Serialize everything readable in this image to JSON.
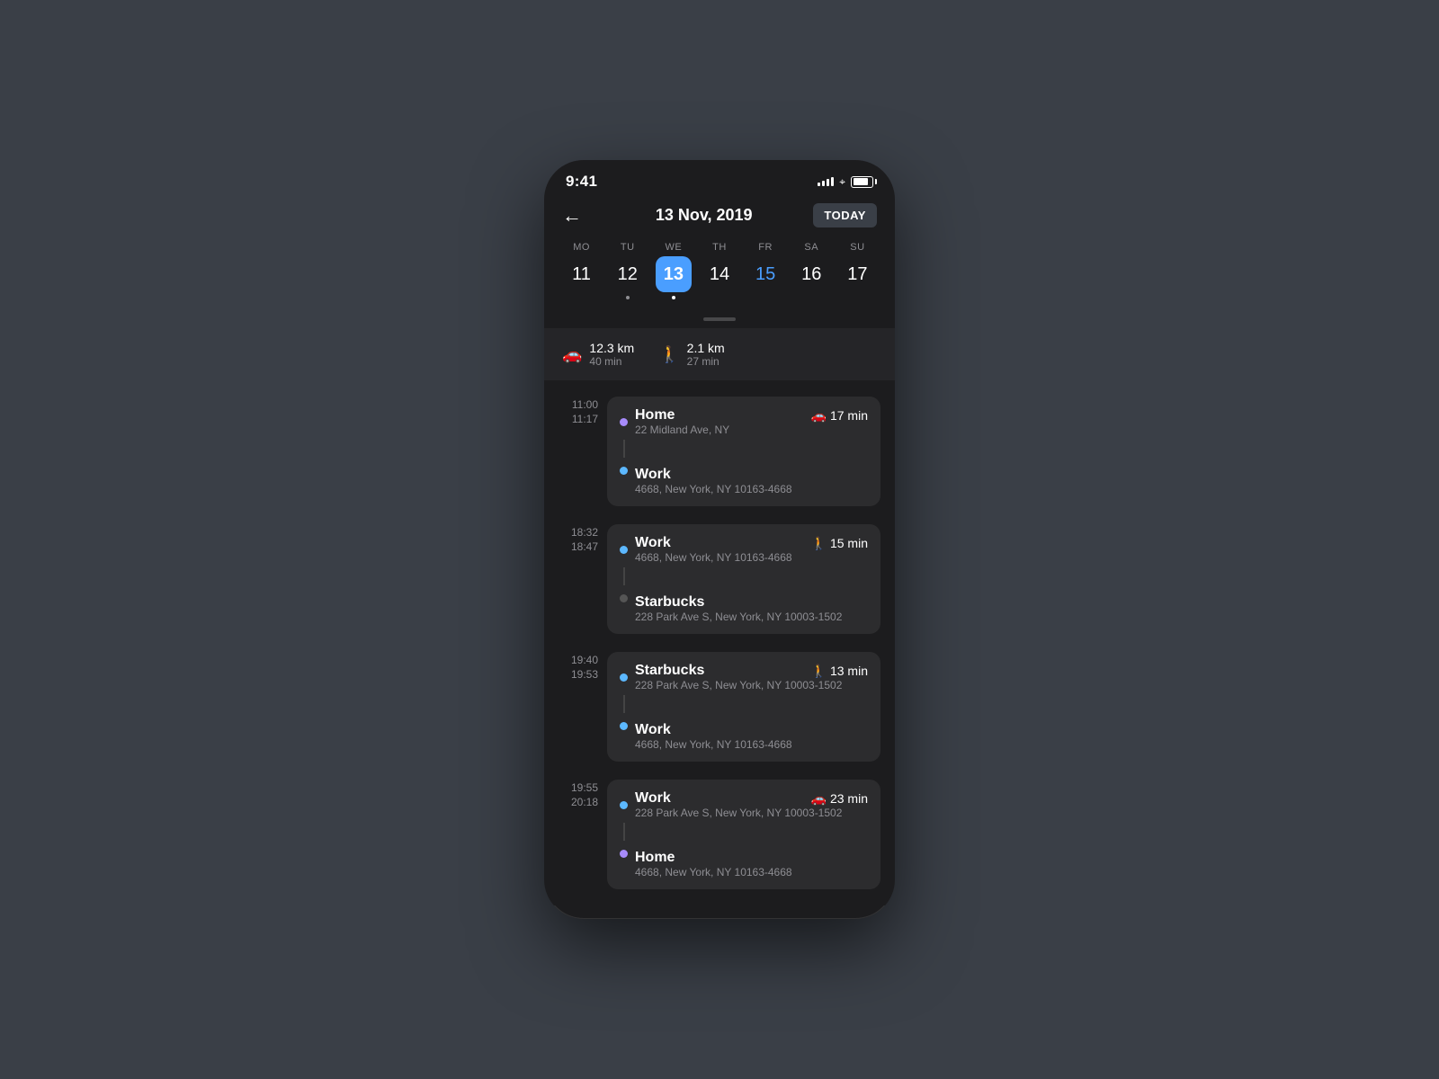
{
  "status": {
    "time": "9:41",
    "signal_bars": [
      4,
      6,
      8,
      10,
      12
    ],
    "wifi": "wifi",
    "battery_pct": 80
  },
  "header": {
    "back_label": "←",
    "title": "13 Nov, 2019",
    "today_label": "TODAY"
  },
  "calendar": {
    "days": [
      {
        "label": "MO",
        "num": "11",
        "selected": false,
        "today": false,
        "dot": false
      },
      {
        "label": "TU",
        "num": "12",
        "selected": false,
        "today": false,
        "dot": true
      },
      {
        "label": "WE",
        "num": "13",
        "selected": true,
        "today": false,
        "dot": true
      },
      {
        "label": "TH",
        "num": "14",
        "selected": false,
        "today": false,
        "dot": false
      },
      {
        "label": "FR",
        "num": "15",
        "selected": false,
        "today": true,
        "dot": false
      },
      {
        "label": "SA",
        "num": "16",
        "selected": false,
        "today": false,
        "dot": false
      },
      {
        "label": "SU",
        "num": "17",
        "selected": false,
        "today": false,
        "dot": false
      }
    ]
  },
  "summary": {
    "car": {
      "distance": "12.3 km",
      "duration": "40 min"
    },
    "walk": {
      "distance": "2.1 km",
      "duration": "27 min"
    }
  },
  "trips": [
    {
      "time_start": "11:00",
      "time_end": "11:17",
      "transport": "car",
      "transport_icon": "🚗",
      "transport_time": "17 min",
      "origin_name": "Home",
      "origin_addr": "22 Midland Ave, NY",
      "origin_dot_color": "#a78bfa",
      "dest_name": "Work",
      "dest_addr": "4668, New York, NY 10163-4668",
      "dest_dot_color": "#5cb8ff"
    },
    {
      "time_start": "18:32",
      "time_end": "18:47",
      "transport": "walk",
      "transport_icon": "🚶",
      "transport_time": "15 min",
      "origin_name": "Work",
      "origin_addr": "4668, New York, NY 10163-4668",
      "origin_dot_color": "#5cb8ff",
      "dest_name": "Starbucks",
      "dest_addr": "228 Park Ave S, New York, NY 10003-1502",
      "dest_dot_color": "#1c1c1e"
    },
    {
      "time_start": "19:40",
      "time_end": "19:53",
      "transport": "walk",
      "transport_icon": "🚶",
      "transport_time": "13 min",
      "origin_name": "Starbucks",
      "origin_addr": "228 Park Ave S, New York, NY 10003-1502",
      "origin_dot_color": "#5cb8ff",
      "dest_name": "Work",
      "dest_addr": "4668, New York, NY 10163-4668",
      "dest_dot_color": "#5cb8ff"
    },
    {
      "time_start": "19:55",
      "time_end": "20:18",
      "transport": "car",
      "transport_icon": "🚗",
      "transport_time": "23 min",
      "origin_name": "Work",
      "origin_addr": "228 Park Ave S, New York, NY 10003-1502",
      "origin_dot_color": "#5cb8ff",
      "dest_name": "Home",
      "dest_addr": "4668, New York, NY 10163-4668",
      "dest_dot_color": "#a78bfa"
    }
  ]
}
